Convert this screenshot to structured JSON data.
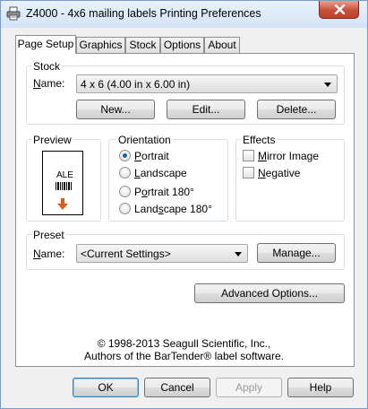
{
  "window": {
    "title": "Z4000 - 4x6 mailing labels Printing Preferences",
    "icon": "printer-icon",
    "close_icon": "close-icon"
  },
  "tabs": [
    {
      "label": "Page Setup",
      "active": true
    },
    {
      "label": "Graphics",
      "active": false
    },
    {
      "label": "Stock",
      "active": false
    },
    {
      "label": "Options",
      "active": false
    },
    {
      "label": "About",
      "active": false
    }
  ],
  "stock": {
    "group_label": "Stock",
    "name_label": "Name:",
    "name_value": "4 x 6 (4.00 in x 6.00 in)",
    "buttons": {
      "new": "New...",
      "edit": "Edit...",
      "delete": "Delete..."
    }
  },
  "preview": {
    "group_label": "Preview",
    "sample_text": "ALE",
    "arrow_color": "#e05a1c"
  },
  "orientation": {
    "group_label": "Orientation",
    "options": [
      {
        "label": "Portrait",
        "checked": true
      },
      {
        "label": "Landscape",
        "checked": false
      },
      {
        "label": "Portrait 180°",
        "checked": false
      },
      {
        "label": "Landscape 180°",
        "checked": false
      }
    ]
  },
  "effects": {
    "group_label": "Effects",
    "options": [
      {
        "label": "Mirror Image",
        "checked": false
      },
      {
        "label": "Negative",
        "checked": false
      }
    ]
  },
  "preset": {
    "group_label": "Preset",
    "name_label": "Name:",
    "name_value": "<Current Settings>",
    "manage_label": "Manage..."
  },
  "advanced_label": "Advanced Options...",
  "copyright": {
    "line1": "© 1998-2013 Seagull Scientific, Inc.,",
    "line2": "Authors of the BarTender® label software."
  },
  "footer": {
    "ok": "OK",
    "cancel": "Cancel",
    "apply": "Apply",
    "help": "Help"
  },
  "colors": {
    "close_button": "#c8503a",
    "selection": "#1a5fa8"
  }
}
